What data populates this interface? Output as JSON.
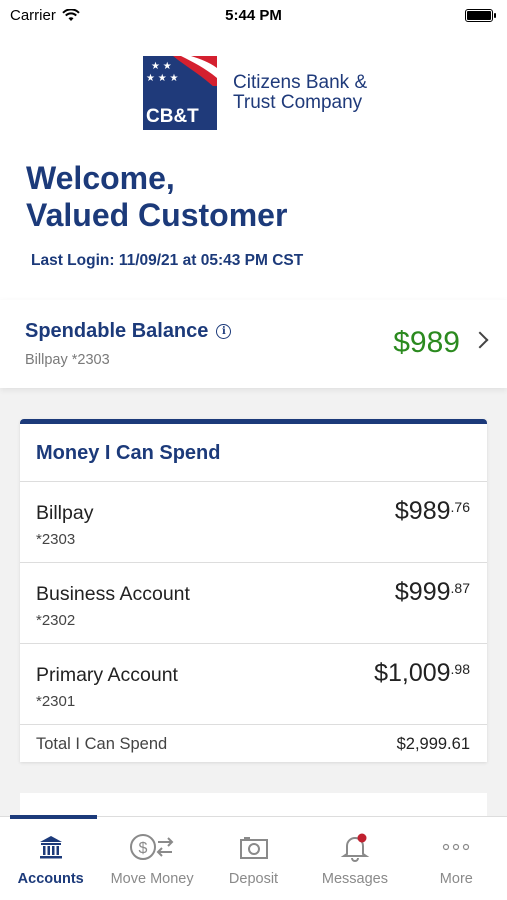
{
  "status_bar": {
    "carrier": "Carrier",
    "time": "5:44 PM"
  },
  "brand": {
    "logo_text": "CB&T",
    "name_line1": "Citizens Bank &",
    "name_line2": "Trust Company"
  },
  "welcome": {
    "line1": "Welcome,",
    "line2": "Valued Customer",
    "last_login": "Last Login: 11/09/21 at 05:43 PM CST"
  },
  "spendable": {
    "title": "Spendable Balance",
    "account": "Billpay *2303",
    "amount": "$989"
  },
  "money_card": {
    "title": "Money I Can Spend",
    "accounts": [
      {
        "name": "Billpay",
        "number": "*2303",
        "amount_whole": "$989",
        "amount_cents": ".76"
      },
      {
        "name": "Business Account",
        "number": "*2302",
        "amount_whole": "$999",
        "amount_cents": ".87"
      },
      {
        "name": "Primary Account",
        "number": "*2301",
        "amount_whole": "$1,009",
        "amount_cents": ".98"
      }
    ],
    "total_label": "Total I Can Spend",
    "total_amount": "$2,999.61"
  },
  "tabs": [
    {
      "label": "Accounts",
      "icon": "bank-icon",
      "active": true
    },
    {
      "label": "Move Money",
      "icon": "transfer-money-icon",
      "active": false
    },
    {
      "label": "Deposit",
      "icon": "camera-icon",
      "active": false
    },
    {
      "label": "Messages",
      "icon": "bell-icon",
      "active": false,
      "badge": true
    },
    {
      "label": "More",
      "icon": "more-dots-icon",
      "active": false
    }
  ],
  "colors": {
    "brand_blue": "#1c3a7a",
    "balance_green": "#2b8a1f",
    "badge_red": "#c0202f"
  }
}
